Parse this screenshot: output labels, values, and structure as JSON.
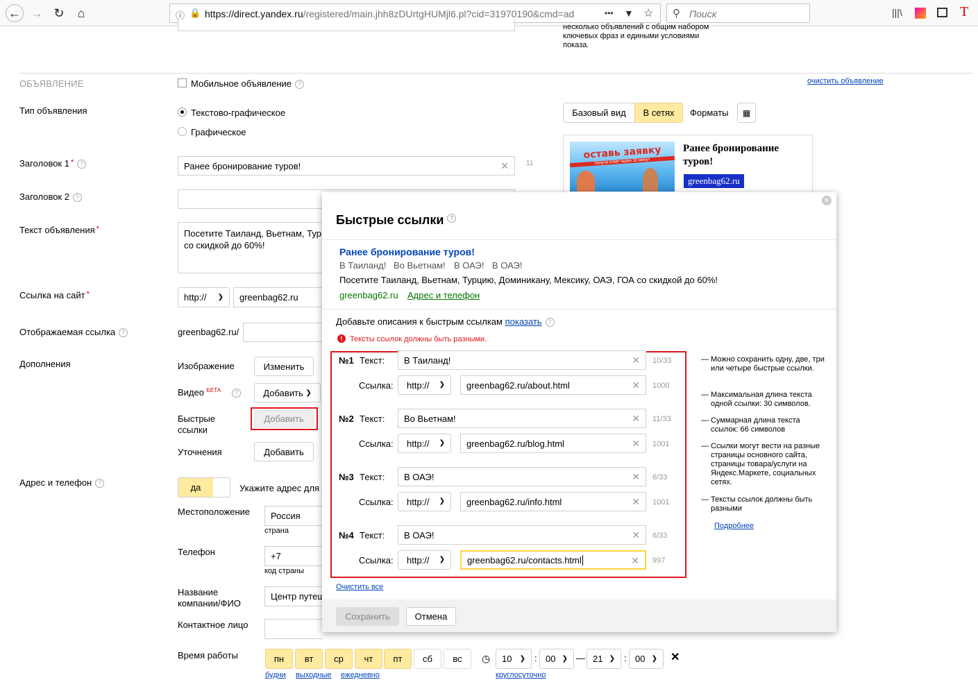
{
  "browser": {
    "url_domain": "https://direct.yandex.ru",
    "url_rest": "/registered/main.jhh8zDUrtgHUMjl6.pl?cid=31970190&cmd=ad",
    "search_placeholder": "Поиск",
    "more_label": "•••"
  },
  "top_note": "несколько объявлений с общим набором ключевых фраз и едиными условиями показа.",
  "section": {
    "title": "ОБЪЯВЛЕНИЕ",
    "mobile_label": "Мобильное объявление",
    "clear_ad": "очистить объявление"
  },
  "form": {
    "ad_type_label": "Тип объявления",
    "type_option1": "Текстово-графическое",
    "type_option2": "Графическое",
    "title1_label": "Заголовок 1",
    "title1_value": "Ранее бронирование туров!",
    "title1_count": "11",
    "title2_label": "Заголовок 2",
    "text_label": "Текст объявления",
    "text_value": "Посетите Таиланд, Вьетнам, Турц\nсо скидкой до 60%!",
    "link_label": "Ссылка на сайт",
    "protocol": "http://",
    "site_value": "greenbag62.ru",
    "display_link_label": "Отображаемая ссылка",
    "display_link_prefix": "greenbag62.ru/",
    "extras_label": "Дополнения",
    "image_label": "Изображение",
    "image_btn": "Изменить",
    "video_label": "Видео",
    "video_beta": "БЕТА",
    "video_btn": "Добавить",
    "quick_links_label": "Быстрые ссылки",
    "quick_links_btn": "Добавить",
    "clarify_label": "Уточнения",
    "clarify_btn": "Добавить",
    "address_label": "Адрес и телефон",
    "toggle_yes": "да",
    "address_hint": "Укажите адрес для",
    "location_label": "Местоположение",
    "country_value": "Россия",
    "country_sub": "страна",
    "phone_label": "Телефон",
    "phone_code": "+7",
    "phone_sub": "код страны",
    "company_label": "Название компании/ФИО",
    "company_value": "Центр путеш",
    "contact_label": "Контактное лицо",
    "hours_label": "Время работы",
    "days": [
      "пн",
      "вт",
      "ср",
      "чт",
      "пт",
      "сб",
      "вс"
    ],
    "days_on": [
      true,
      true,
      true,
      true,
      true,
      false,
      false
    ],
    "day_links": [
      "будни",
      "выходные",
      "ежедневно"
    ],
    "hour_from": "10",
    "min_from": "00",
    "hour_to": "21",
    "min_to": "00",
    "round_clock": "круглосуточно"
  },
  "preview": {
    "tab_basic": "Базовый вид",
    "tab_networks": "В сетях",
    "tab_formats": "Форматы",
    "banner_text1": "оставь заявку",
    "banner_text2": "получи ответ через 10 минут",
    "ad_title": "Ранее бронирование туров!",
    "domain_badge": "greenbag62.ru"
  },
  "modal": {
    "title": "Быстрые ссылки",
    "preview_title": "Ранее бронирование туров!",
    "preview_links": [
      "В Таиланд!",
      "Во Вьетнам!",
      "В ОАЭ!",
      "В ОАЭ!"
    ],
    "preview_text": "Посетите Таиланд, Вьетнам, Турцию, Доминикану, Мексику, ОАЭ, ГОА со скидкой до 60%!",
    "preview_domain": "greenbag62.ru",
    "preview_address": "Адрес и телефон",
    "desc_prompt": "Добавьте описания к быстрым ссылкам",
    "desc_show": "показать",
    "error": "Тексты ссылок должны быть разными.",
    "text_label": "Текст:",
    "link_label": "Ссылка:",
    "protocol": "http://",
    "links": [
      {
        "num": "№1",
        "text": "В Таиланд!",
        "text_count": "10/33",
        "url": "greenbag62.ru/about.html",
        "url_count": "1000"
      },
      {
        "num": "№2",
        "text": "Во Вьетнам!",
        "text_count": "11/33",
        "url": "greenbag62.ru/blog.html",
        "url_count": "1001"
      },
      {
        "num": "№3",
        "text": "В ОАЭ!",
        "text_count": "6/33",
        "url": "greenbag62.ru/info.html",
        "url_count": "1001"
      },
      {
        "num": "№4",
        "text": "В ОАЭ!",
        "text_count": "6/33",
        "url": "greenbag62.ru/contacts.html",
        "url_count": "997"
      }
    ],
    "hints": [
      "Можно сохранить одну, две, три или четыре быстрые ссылки.",
      "Максимальная длина текста одной ссылки: 30 символов.",
      "Суммарная длина текста ссылок: 66 символов",
      "Ссылки могут вести на разные страницы основного сайта, страницы товара/услуги на Яндекс.Маркете, социальных сетях.",
      "Тексты ссылок должны быть разными"
    ],
    "more": "Подробнее",
    "clear_all": "Очистить все",
    "save": "Сохранить",
    "cancel": "Отмена"
  },
  "colors": {
    "highlight_red": "#e0161d",
    "link_blue": "#0044bb",
    "green": "#007700",
    "yellow": "#ffeba0"
  }
}
